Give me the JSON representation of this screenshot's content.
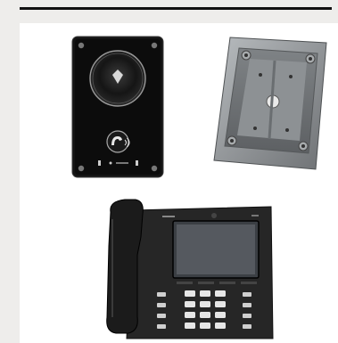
{
  "products": {
    "intercom": {
      "icon": "intercom-icon",
      "accent": "#1f1f1f"
    },
    "box": {
      "icon": "mounting-box-icon",
      "accent": "#8a8d90"
    },
    "phone": {
      "icon": "desk-phone-icon",
      "accent": "#1c1c1c"
    }
  }
}
